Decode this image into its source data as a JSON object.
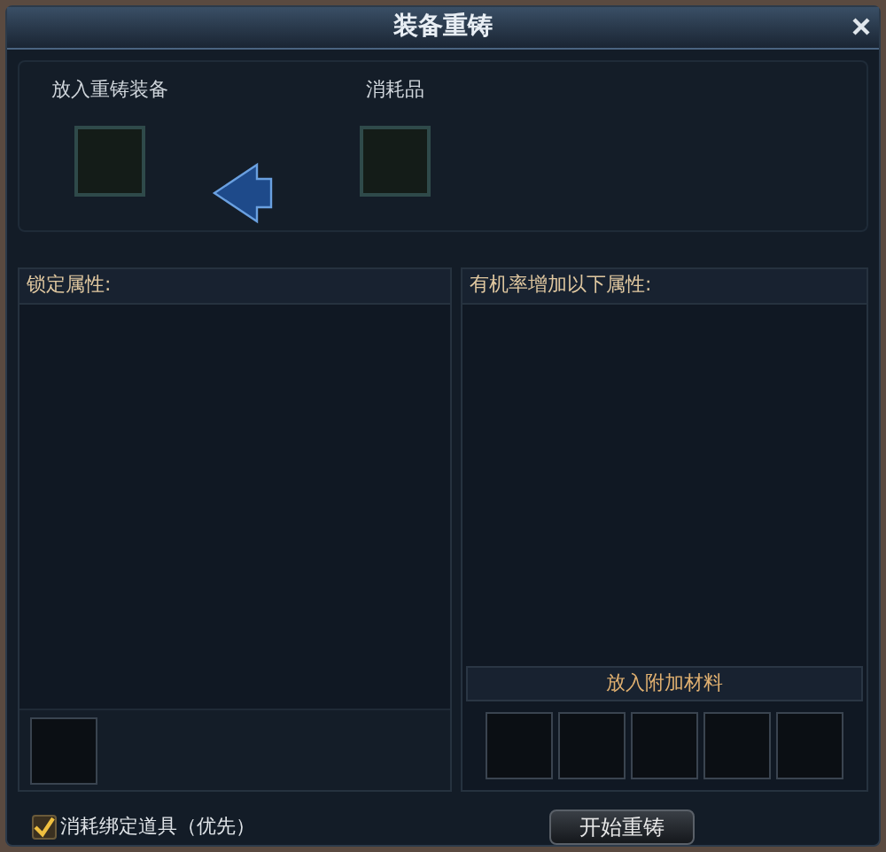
{
  "window": {
    "title": "装备重铸"
  },
  "equip_slot": {
    "label": "放入重铸装备"
  },
  "consumable_slot": {
    "label": "消耗品"
  },
  "locked_panel": {
    "title": "锁定属性:",
    "slots": [
      {
        "kind": "empty"
      }
    ]
  },
  "chance_panel": {
    "title": "有机率增加以下属性:"
  },
  "material_section": {
    "title": "放入附加材料",
    "slots": [
      {
        "kind": "empty"
      },
      {
        "kind": "empty"
      },
      {
        "kind": "empty"
      },
      {
        "kind": "empty"
      },
      {
        "kind": "empty"
      }
    ]
  },
  "bind_option": {
    "label": "消耗绑定道具（优先）",
    "checked": true
  },
  "start_button": {
    "label": "开始重铸"
  }
}
